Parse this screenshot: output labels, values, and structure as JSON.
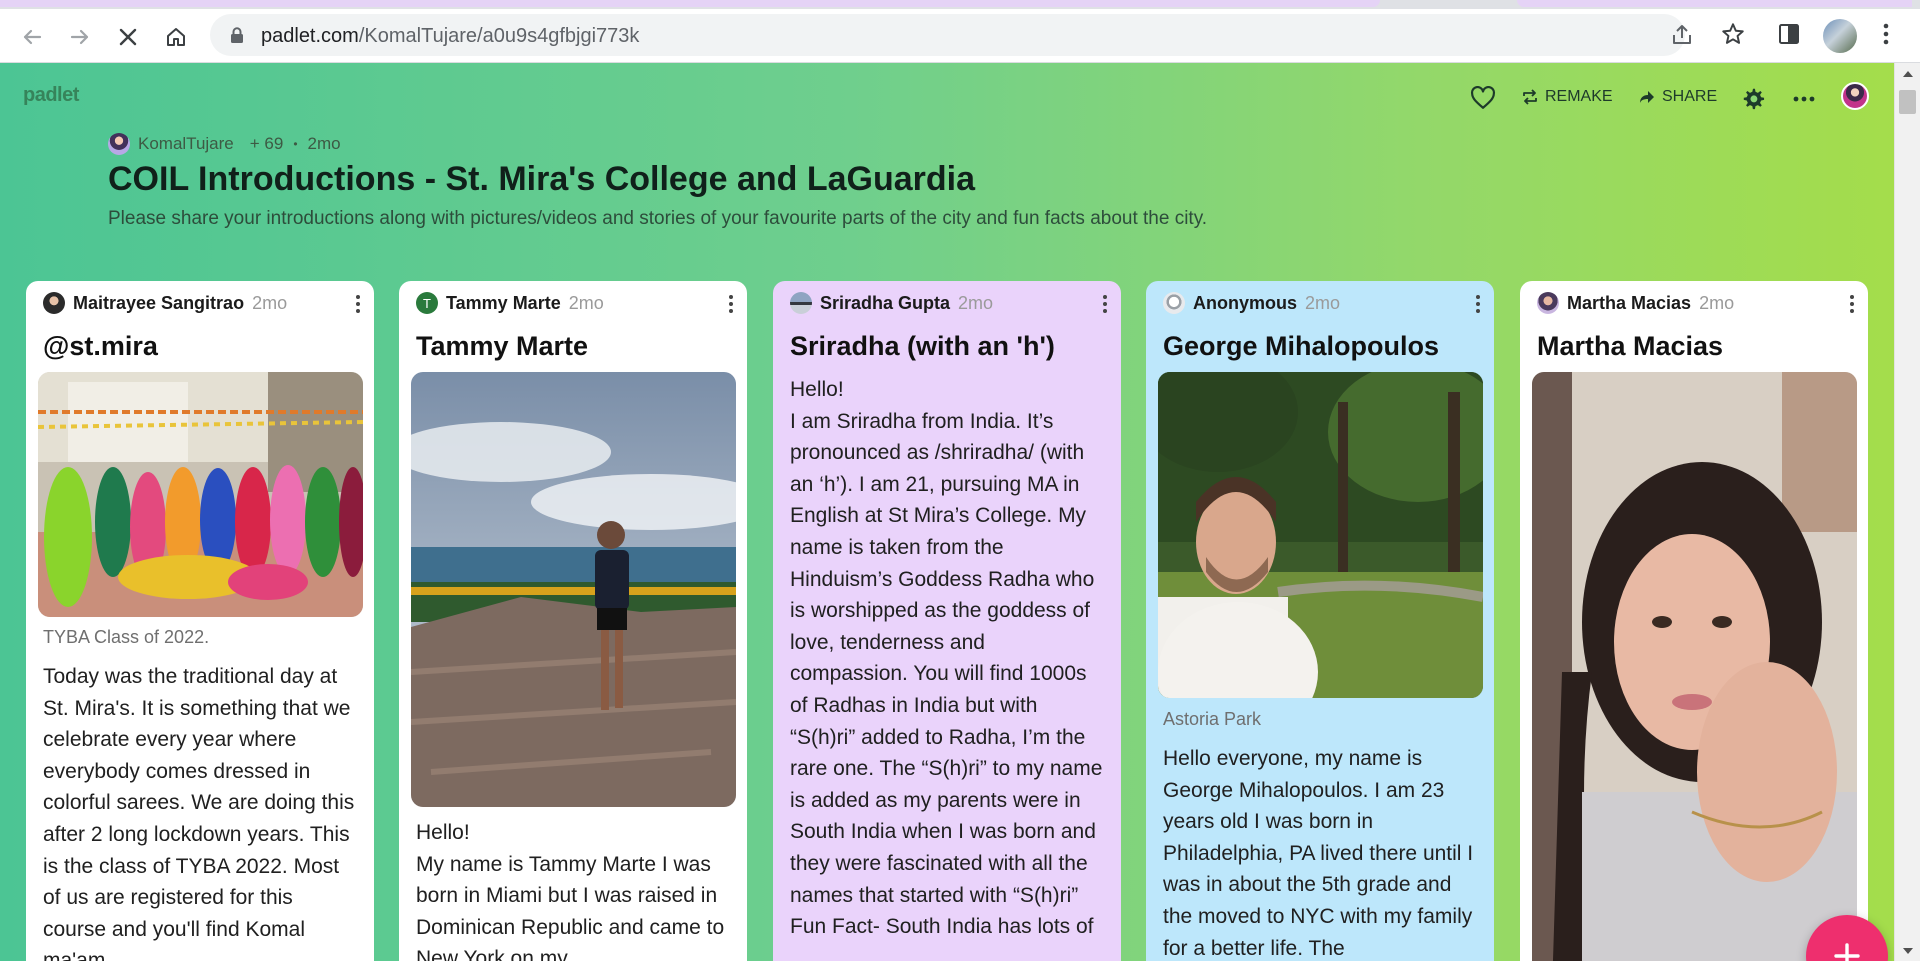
{
  "browser": {
    "url_host": "padlet.com",
    "url_path": "/KomalTujare/a0u9s4gfbjgi773k"
  },
  "padlet": {
    "brand": "padlet",
    "actions": {
      "remake": "REMAKE",
      "share": "SHARE"
    },
    "author": "KomalTujare",
    "likes": "+ 69",
    "separator": "•",
    "age": "2mo",
    "title": "COIL Introductions - St. Mira's College and LaGuardia",
    "description": "Please share your introductions along with pictures/videos and stories of your favourite parts of the city and fun facts about the city."
  },
  "posts": [
    {
      "author": "Maitrayee Sangitrao",
      "time": "2mo",
      "title": "@st.mira",
      "caption": "TYBA Class of 2022.",
      "body": "Today was the traditional day at St. Mira's. It is something that we celebrate every year where everybody comes dressed in colorful sarees. We are doing this after 2 long lockdown years. This is the class of TYBA 2022. Most of us are registered for this course and you'll find Komal ma'am"
    },
    {
      "author": "Tammy Marte",
      "avatar_letter": "T",
      "time": "2mo",
      "title": "Tammy Marte",
      "body": "Hello!\nMy name is Tammy Marte I was born in Miami but I was raised in Dominican Republic and came to New York on my"
    },
    {
      "author": "Sriradha Gupta",
      "time": "2mo",
      "title": "Sriradha (with an 'h')",
      "body": "Hello!\nI am Sriradha from India. It’s pronounced as /shriradha/ (with an ‘h’). I am 21, pursuing MA in English at St Mira’s College. My name is taken from the Hinduism’s Goddess Radha who is worshipped as the goddess of love, tenderness and compassion. You will find 1000s of Radhas in India but with “S(h)ri” added to Radha, I’m the rare one. The “S(h)ri” to my name is added as my parents were in South India when I was born and they were fascinated with all the names that started with “S(h)ri”  Fun Fact- South India has lots of"
    },
    {
      "author": "Anonymous",
      "time": "2mo",
      "title": "George Mihalopoulos",
      "caption": "Astoria Park",
      "body": "Hello everyone, my name is George Mihalopoulos. I am 23 years old I was born in Philadelphia, PA lived there until I was in about the 5th grade and the moved to NYC with my family for a better life. The"
    },
    {
      "author": "Martha Macias",
      "time": "2mo",
      "title": "Martha Macias"
    }
  ]
}
